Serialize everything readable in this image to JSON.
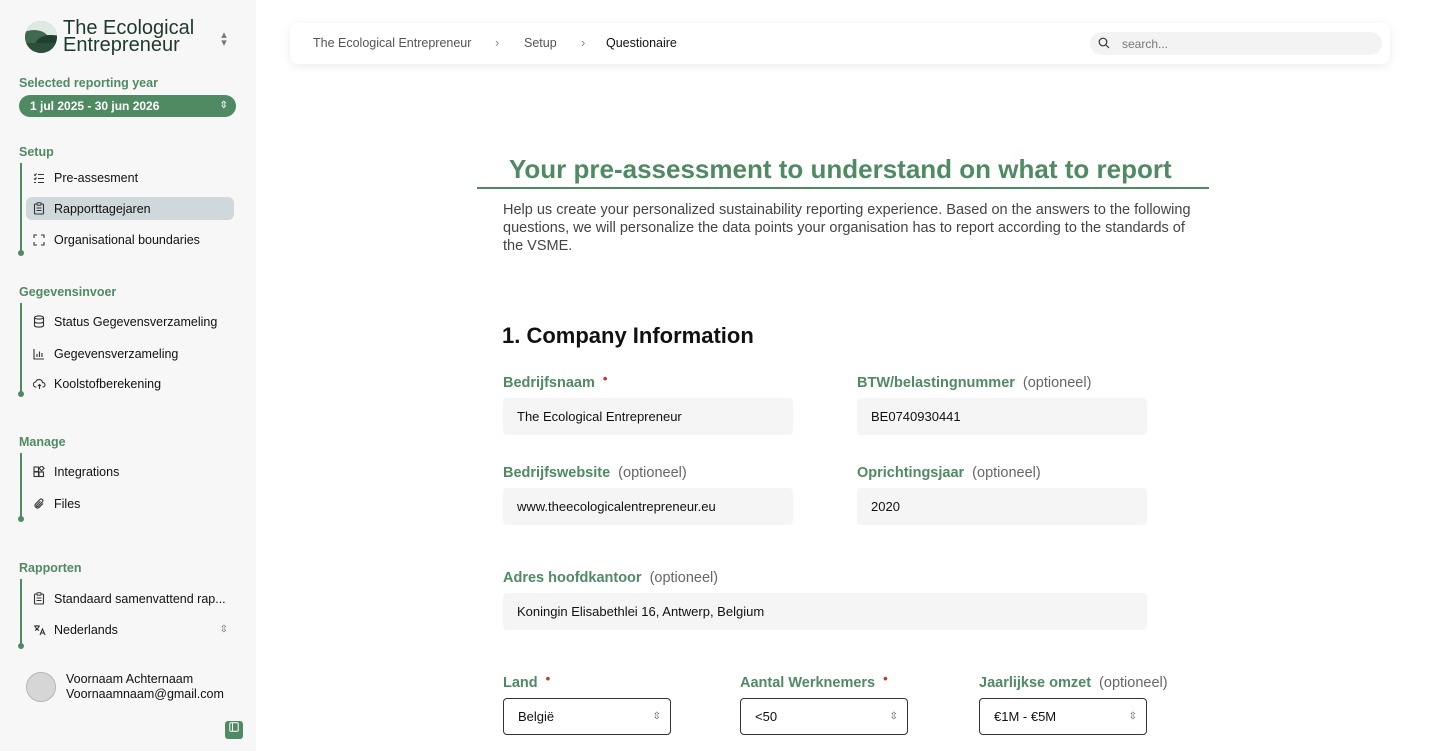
{
  "sidebar": {
    "brand_name": "The Ecological Entrepreneur",
    "reporting_year_label": "Selected reporting year",
    "reporting_year_value": "1 jul 2025 - 30 jun 2026",
    "sections": {
      "setup": {
        "title": "Setup",
        "items": [
          "Pre-assesment",
          "Rapporttagejaren",
          "Organisational boundaries"
        ]
      },
      "data_entry": {
        "title": "Gegevensinvoer",
        "items": [
          "Status Gegevensverzameling",
          "Gegevensverzameling",
          "Koolstofberekening"
        ]
      },
      "manage": {
        "title": "Manage",
        "items": [
          "Integrations",
          "Files"
        ]
      },
      "reports": {
        "title": "Rapporten",
        "items": [
          "Standaard samenvattend rap...",
          "Nederlands"
        ]
      }
    },
    "user": {
      "name": "Voornaam Achternaam",
      "email": "Voornaamnaam@gmail.com"
    }
  },
  "header": {
    "breadcrumb": [
      "The Ecological Entrepreneur",
      "Setup",
      "Questionaire"
    ],
    "search_placeholder": "search..."
  },
  "main": {
    "headline": "Your pre-assessment to understand on what to report",
    "intro": "Help us create your personalized sustainability reporting experience. Based on the answers to the following questions, we will personalize the data points your organisation has to report according to the standards of the VSME.",
    "section_title": "1. Company Information",
    "optional_tag": "(optioneel)",
    "required_mark": "•",
    "fields": {
      "company_name": {
        "label": "Bedrijfsnaam",
        "value": "The Ecological Entrepreneur"
      },
      "vat_number": {
        "label": "BTW/belastingnummer",
        "value": "BE0740930441"
      },
      "website": {
        "label": "Bedrijfswebsite",
        "value": "www.theecologicalentrepreneur.eu"
      },
      "founding_year": {
        "label": "Oprichtingsjaar",
        "value": "2020"
      },
      "hq_address": {
        "label": "Adres hoofdkantoor",
        "value": "Koningin Elisabethlei 16, Antwerp, Belgium"
      },
      "country": {
        "label": "Land",
        "value": "België"
      },
      "employees": {
        "label": "Aantal Werknemers",
        "value": "<50"
      },
      "revenue": {
        "label": "Jaarlijkse omzet",
        "value": "€1M - €5M"
      }
    }
  },
  "colors": {
    "accent": "#4f8a63",
    "required": "#c0392b",
    "sidebar_bg": "#f7f7f7",
    "active_item_bg": "#cfd8da"
  }
}
